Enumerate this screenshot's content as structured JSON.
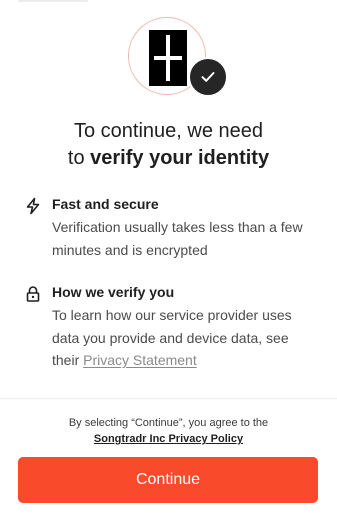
{
  "headline": {
    "line1": "To continue, we need",
    "line2_prefix": "to ",
    "line2_bold": "verify your identity"
  },
  "features": [
    {
      "icon": "lightning-icon",
      "title": "Fast and secure",
      "description": "Verification usually takes less than a few minutes and is encrypted"
    },
    {
      "icon": "lock-icon",
      "title": "How we verify you",
      "description": "To learn how our service provider uses data you provide and device data, see their ",
      "link_label": "Privacy Statement"
    }
  ],
  "consent": {
    "text": "By selecting “Continue”, you agree to the",
    "link_label": "Songtradr Inc Privacy Policy"
  },
  "continue_button": {
    "label": "Continue"
  },
  "colors": {
    "accent": "#fa4a2c",
    "badge": "#262626",
    "logo_ring": "#f3b8b0"
  }
}
